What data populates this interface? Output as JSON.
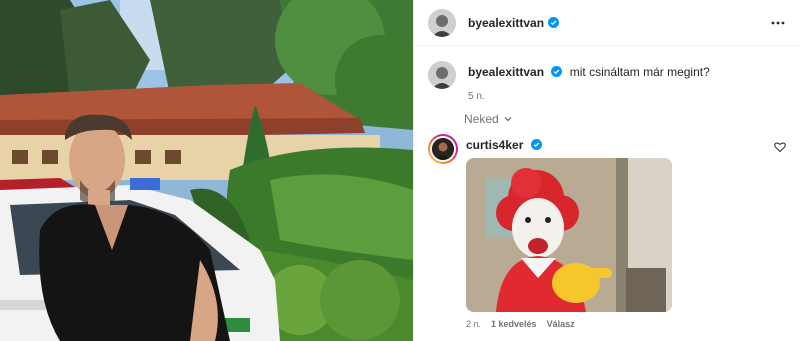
{
  "post": {
    "author": "byealexittvan",
    "caption": "mit csináltam már megint?",
    "caption_age": "5 n.",
    "more_icon": "more-horizontal-icon",
    "verified_color": "#0095f6"
  },
  "filter": {
    "label": "Neked",
    "icon": "chevron-down-icon"
  },
  "comments": [
    {
      "user": "curtis4ker",
      "verified": true,
      "media": "gif",
      "age": "2 n.",
      "likes": "1 kedvelés",
      "reply": "Válasz",
      "like_icon": "heart-icon"
    }
  ]
}
